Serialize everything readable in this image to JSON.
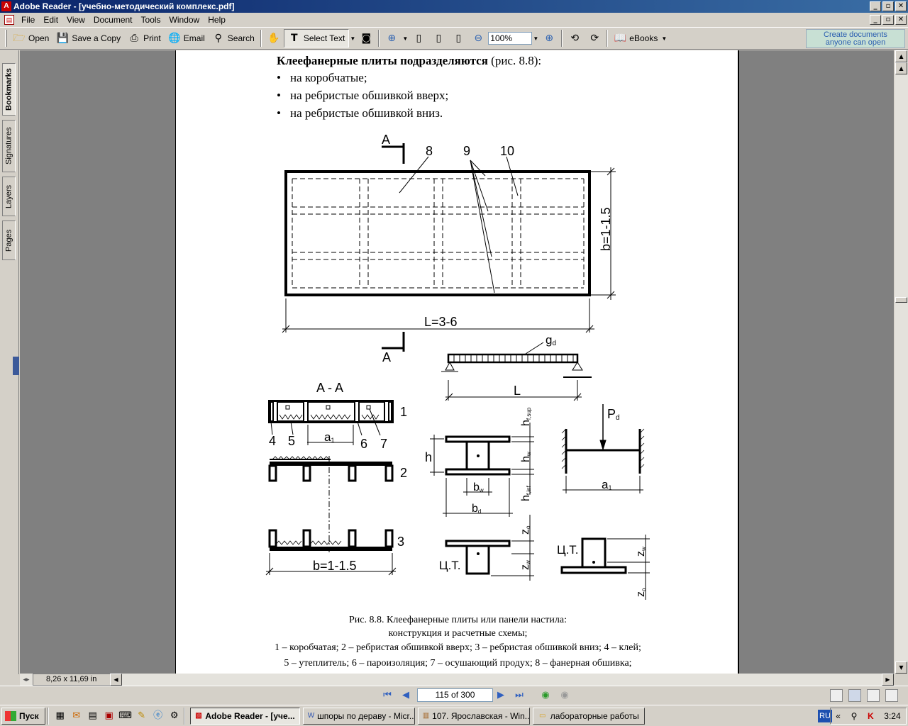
{
  "window": {
    "title": "Adobe Reader - [учебно-методический комплекс.pdf]",
    "app_icon": "A",
    "minimize": "_",
    "restore": "▫",
    "close": "✕"
  },
  "menu": [
    "File",
    "Edit",
    "View",
    "Document",
    "Tools",
    "Window",
    "Help"
  ],
  "toolbar": {
    "open": "Open",
    "save_copy": "Save a Copy",
    "print": "Print",
    "email": "Email",
    "search": "Search",
    "select_text": "Select Text",
    "zoom_value": "100%",
    "ebooks": "eBooks",
    "promo_line1": "Create documents",
    "promo_line2": "anyone can open"
  },
  "nav_tabs": [
    "Bookmarks",
    "Signatures",
    "Layers",
    "Pages"
  ],
  "document": {
    "heading_bold": "Клеефанерные плиты подразделяются",
    "heading_rest": " (рис. 8.8):",
    "bullets": [
      "на коробчатые;",
      "на ребристые обшивкой вверх;",
      "на ребристые обшивкой вниз."
    ],
    "figure_labels": {
      "A_top": "A",
      "n8": "8",
      "n9": "9",
      "n10": "10",
      "b_dim": "b=1-1.5",
      "L_dim": "L=3-6",
      "A_bottom": "A",
      "gd": "g",
      "gd_sub": "d",
      "L": "L",
      "section": "A - A",
      "n1": "1",
      "n2": "2",
      "n3": "3",
      "n4": "4",
      "n5": "5",
      "n6": "6",
      "n7": "7",
      "a1": "a",
      "a1_sub": "1",
      "b_bottom": "b=1-1.5",
      "h": "h",
      "hf_sup": "h",
      "hf_sup_sub": "f,sup",
      "hw": "h",
      "hw_sub": "w",
      "hf_inf": "h",
      "hf_inf_sub": "f,inf",
      "bw": "b",
      "bw_sub": "w",
      "bd": "b",
      "bd_sub": "d",
      "Pd": "P",
      "Pd_sub": "d",
      "a1b": "a",
      "a1b_sub": "1",
      "zo": "z",
      "zo_sub": "o",
      "zw": "z",
      "zw_sub": "w",
      "ct1": "Ц.Т.",
      "ct2": "Ц.Т.",
      "zw2": "z",
      "zw2_sub": "w",
      "zo2": "z",
      "zo2_sub": "o"
    },
    "caption_line1": "Рис. 8.8. Клеефанерные плиты или панели настила:",
    "caption_line2": "конструкция и расчетные схемы;",
    "caption_line3": "1 – коробчатая; 2 – ребристая обшивкой вверх; 3 – ребристая обшивкой вниз; 4 – клей;",
    "caption_line4": "5 – утеплитель; 6 – пароизоляция; 7 – осушающий продух; 8 – фанерная обшивка;"
  },
  "status": {
    "page_size": "8,26 x 11,69 in",
    "page_indicator": "115 of 300"
  },
  "taskbar": {
    "start": "Пуск",
    "tasks": [
      "Adobe Reader - [уче...",
      "шпоры по дераву - Micr...",
      "107. Ярославская - Win...",
      "лабораторные работы"
    ],
    "lang": "RU",
    "clock": "3:24"
  }
}
